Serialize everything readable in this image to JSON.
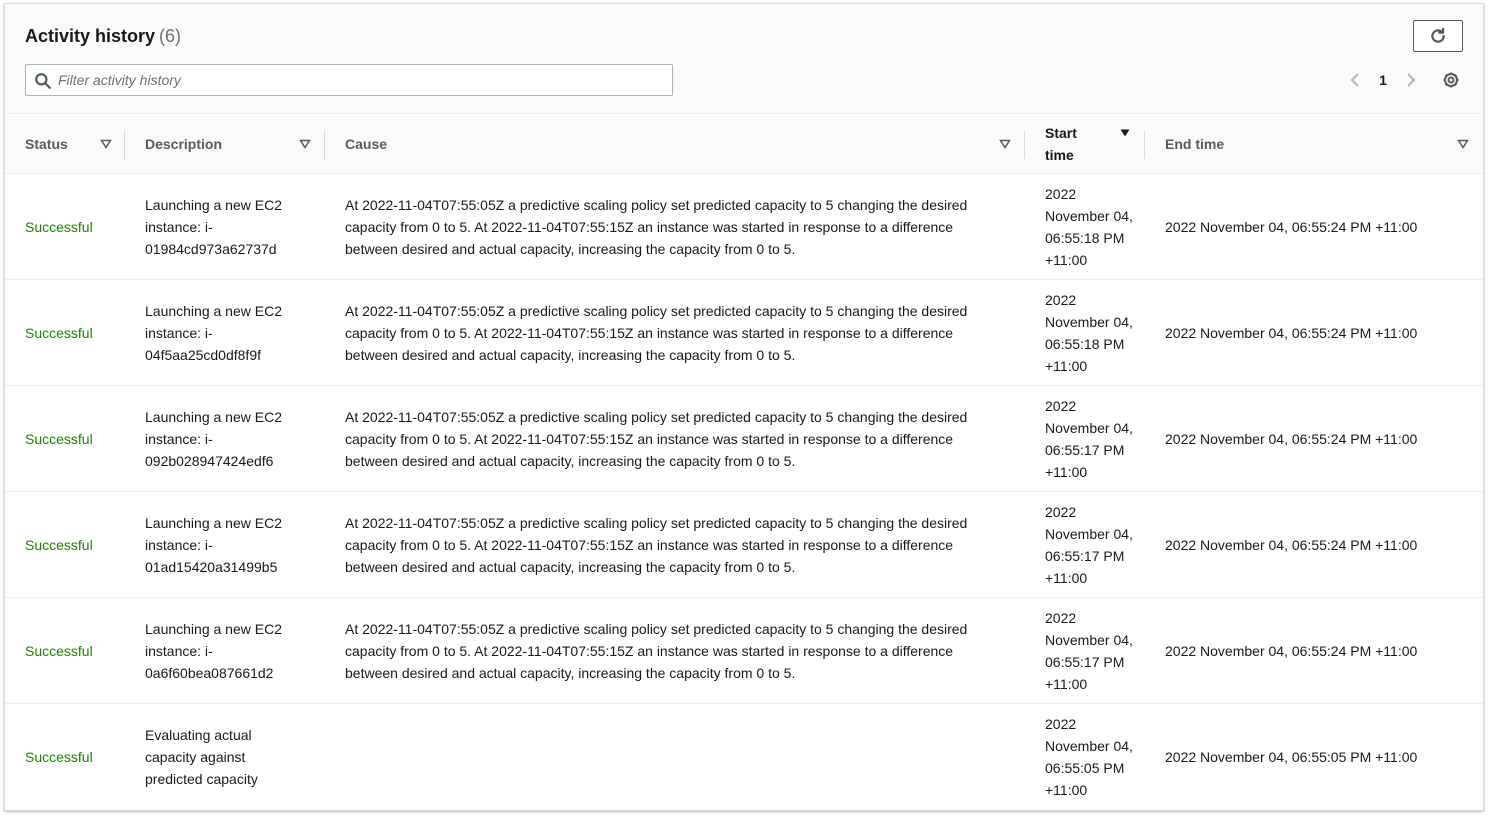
{
  "header": {
    "title": "Activity history",
    "count": "(6)",
    "search_placeholder": "Filter activity history",
    "page": "1"
  },
  "columns": {
    "status": "Status",
    "description": "Description",
    "cause": "Cause",
    "start_time": "Start time",
    "end_time": "End time"
  },
  "rows": [
    {
      "status": "Successful",
      "description": "Launching a new EC2 instance: i-01984cd973a62737d",
      "cause": "At 2022-11-04T07:55:05Z a predictive scaling policy set predicted capacity to 5 changing the desired capacity from 0 to 5. At 2022-11-04T07:55:15Z an instance was started in response to a difference between desired and actual capacity, increasing the capacity from 0 to 5.",
      "start_time": "2022 November 04, 06:55:18 PM +11:00",
      "end_time": "2022 November 04, 06:55:24 PM +11:00"
    },
    {
      "status": "Successful",
      "description": "Launching a new EC2 instance: i-04f5aa25cd0df8f9f",
      "cause": "At 2022-11-04T07:55:05Z a predictive scaling policy set predicted capacity to 5 changing the desired capacity from 0 to 5. At 2022-11-04T07:55:15Z an instance was started in response to a difference between desired and actual capacity, increasing the capacity from 0 to 5.",
      "start_time": "2022 November 04, 06:55:18 PM +11:00",
      "end_time": "2022 November 04, 06:55:24 PM +11:00"
    },
    {
      "status": "Successful",
      "description": "Launching a new EC2 instance: i-092b028947424edf6",
      "cause": "At 2022-11-04T07:55:05Z a predictive scaling policy set predicted capacity to 5 changing the desired capacity from 0 to 5. At 2022-11-04T07:55:15Z an instance was started in response to a difference between desired and actual capacity, increasing the capacity from 0 to 5.",
      "start_time": "2022 November 04, 06:55:17 PM +11:00",
      "end_time": "2022 November 04, 06:55:24 PM +11:00"
    },
    {
      "status": "Successful",
      "description": "Launching a new EC2 instance: i-01ad15420a31499b5",
      "cause": "At 2022-11-04T07:55:05Z a predictive scaling policy set predicted capacity to 5 changing the desired capacity from 0 to 5. At 2022-11-04T07:55:15Z an instance was started in response to a difference between desired and actual capacity, increasing the capacity from 0 to 5.",
      "start_time": "2022 November 04, 06:55:17 PM +11:00",
      "end_time": "2022 November 04, 06:55:24 PM +11:00"
    },
    {
      "status": "Successful",
      "description": "Launching a new EC2 instance: i-0a6f60bea087661d2",
      "cause": "At 2022-11-04T07:55:05Z a predictive scaling policy set predicted capacity to 5 changing the desired capacity from 0 to 5. At 2022-11-04T07:55:15Z an instance was started in response to a difference between desired and actual capacity, increasing the capacity from 0 to 5.",
      "start_time": "2022 November 04, 06:55:17 PM +11:00",
      "end_time": "2022 November 04, 06:55:24 PM +11:00"
    },
    {
      "status": "Successful",
      "description": "Evaluating actual capacity against predicted capacity",
      "cause": "",
      "start_time": "2022 November 04, 06:55:05 PM +11:00",
      "end_time": "2022 November 04, 06:55:05 PM +11:00"
    }
  ],
  "colors": {
    "success": "#1d8102",
    "header_bg": "#fafafa",
    "border": "#eaeded"
  },
  "icons": {
    "search": "search-icon",
    "refresh": "refresh-icon",
    "prev": "chevron-left-icon",
    "next": "chevron-right-icon",
    "settings": "gear-icon",
    "sort": "sort-triangle-icon"
  }
}
